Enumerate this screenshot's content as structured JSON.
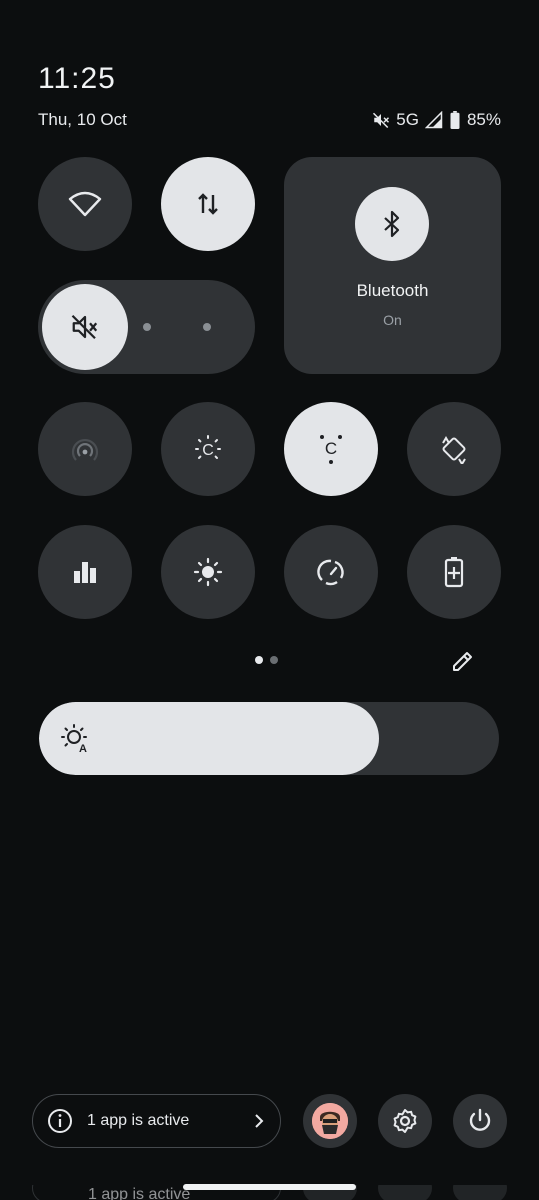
{
  "status": {
    "time": "11:25",
    "date": "Thu, 10 Oct",
    "network": "5G",
    "battery": "85%",
    "icons": [
      "mute-icon",
      "signal-icon",
      "battery-icon"
    ]
  },
  "tiles": {
    "wifi": {
      "name": "Wi-Fi",
      "on": false
    },
    "mobile_data": {
      "name": "Mobile data",
      "on": true
    },
    "bluetooth": {
      "label": "Bluetooth",
      "state": "On",
      "on": true
    },
    "sound_mode": {
      "icon": "mute-icon",
      "positions": 3,
      "selected": 0
    },
    "row2": [
      {
        "icon": "hotspot-icon",
        "on": false
      },
      {
        "icon": "night-light-icon",
        "on": false
      },
      {
        "icon": "reading-mode-icon",
        "on": true
      },
      {
        "icon": "auto-rotate-icon",
        "on": false
      }
    ],
    "row3": [
      {
        "icon": "data-usage-icon",
        "on": false
      },
      {
        "icon": "brightness-icon",
        "on": false
      },
      {
        "icon": "data-saver-icon",
        "on": false
      },
      {
        "icon": "battery-saver-icon",
        "on": false
      }
    ]
  },
  "pager": {
    "pages": 2,
    "current": 0
  },
  "brightness": {
    "level": 0.74,
    "icon": "auto-brightness-icon"
  },
  "footer": {
    "active_apps_label": "1 app is active",
    "buttons": [
      "avatar",
      "settings-icon",
      "power-icon"
    ]
  },
  "colors": {
    "tile_off": "#303336",
    "tile_on": "#e3e5e8",
    "background": "#0c0e0f"
  }
}
